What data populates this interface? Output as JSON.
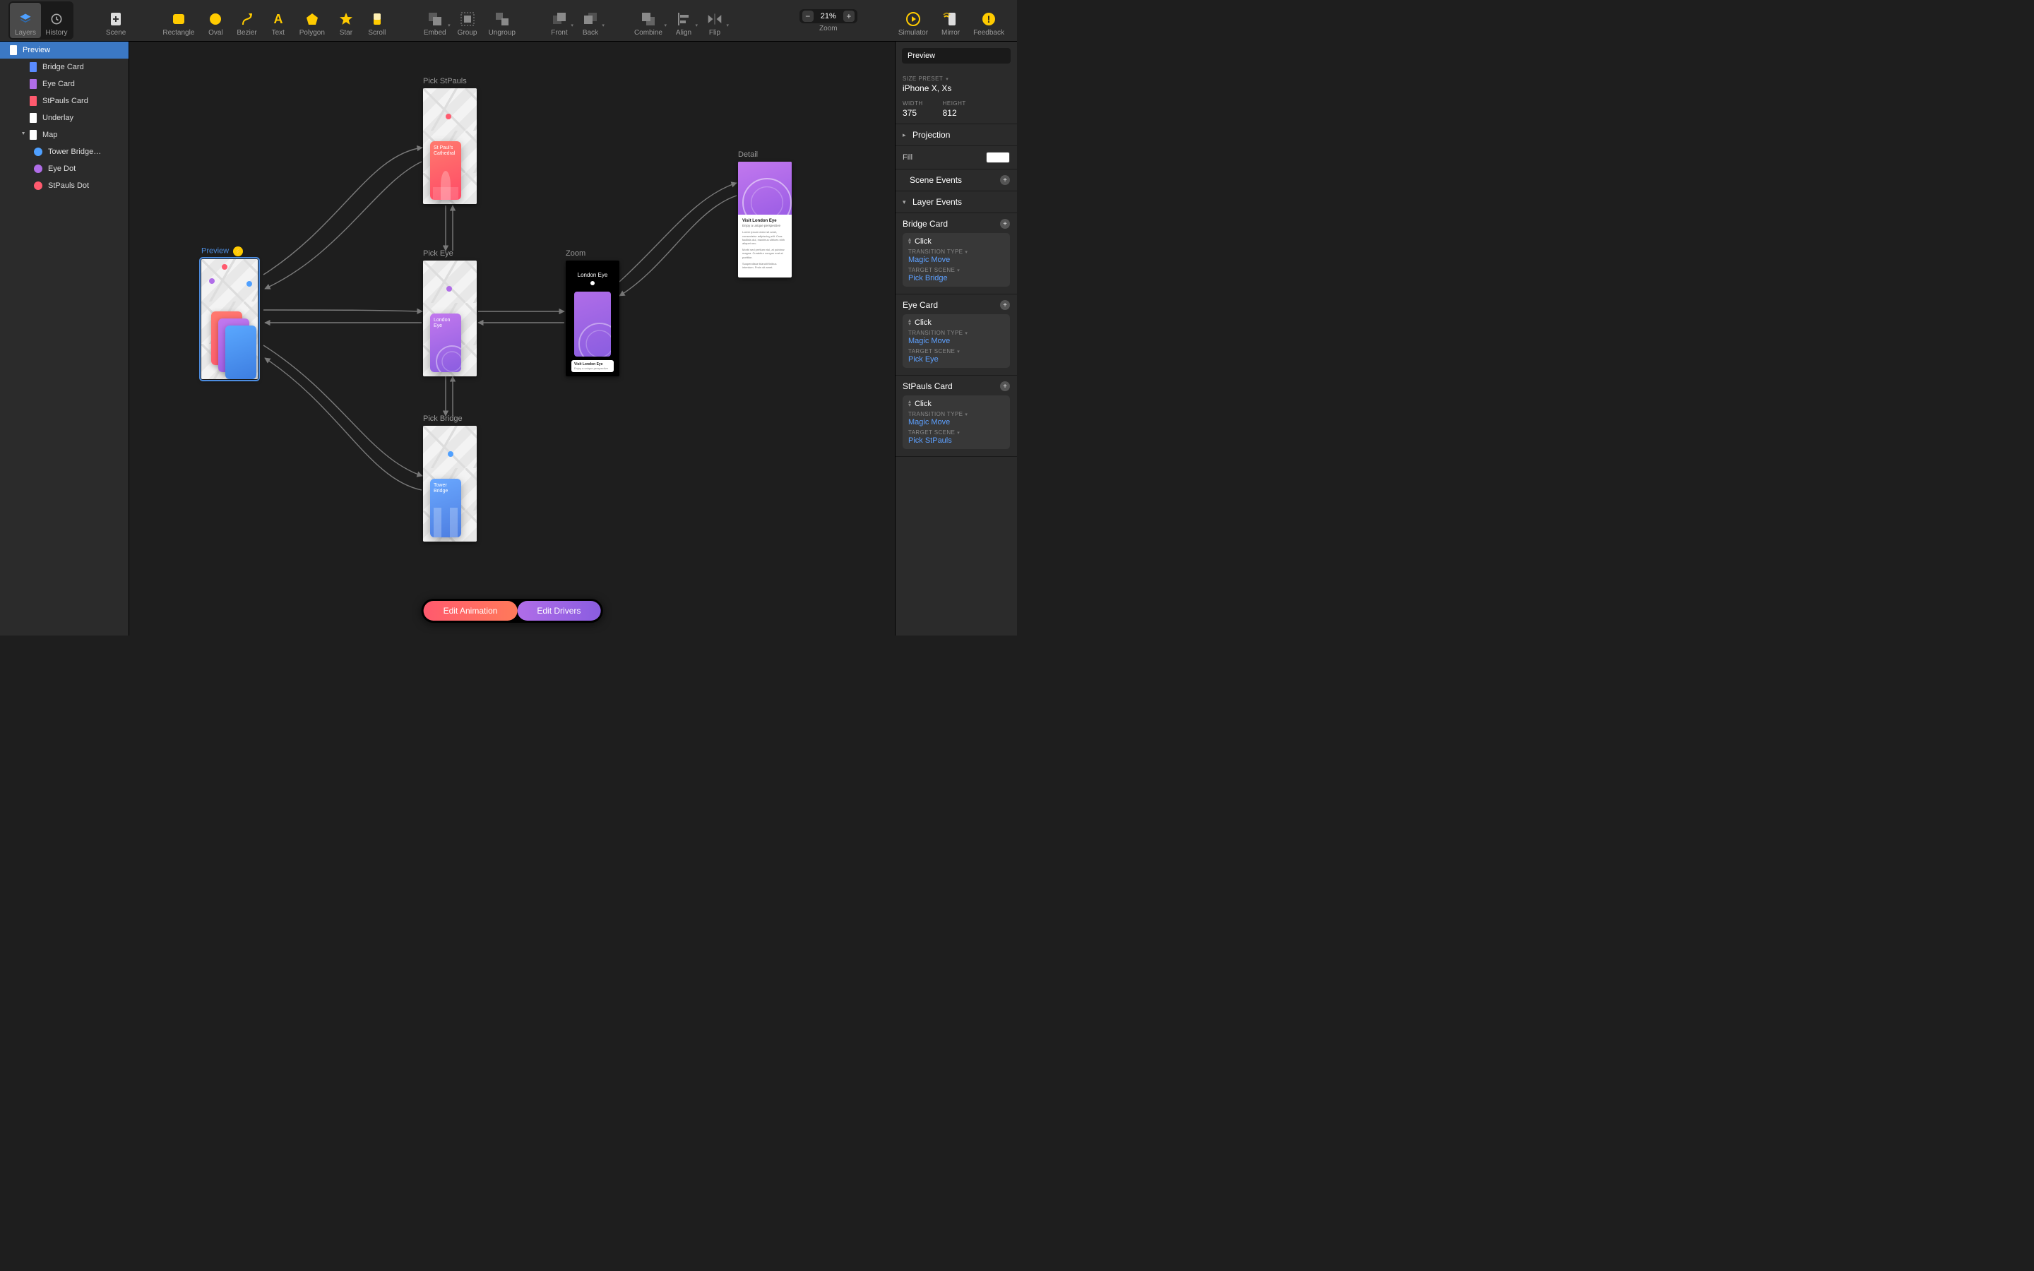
{
  "toolbar": {
    "layers": "Layers",
    "history": "History",
    "scene": "Scene",
    "rectangle": "Rectangle",
    "oval": "Oval",
    "bezier": "Bezier",
    "text": "Text",
    "polygon": "Polygon",
    "star": "Star",
    "scroll": "Scroll",
    "embed": "Embed",
    "group": "Group",
    "ungroup": "Ungroup",
    "front": "Front",
    "back": "Back",
    "combine": "Combine",
    "align": "Align",
    "flip": "Flip",
    "zoom_label": "Zoom",
    "zoom_value": "21%",
    "simulator": "Simulator",
    "mirror": "Mirror",
    "feedback": "Feedback"
  },
  "layers": [
    {
      "name": "Preview",
      "swatch": "#ffffff",
      "selected": true,
      "indent": 0,
      "kind": "rect"
    },
    {
      "name": "Bridge Card",
      "swatch": "#5a8bff",
      "selected": false,
      "indent": 1,
      "kind": "rect"
    },
    {
      "name": "Eye Card",
      "swatch": "#b06de8",
      "selected": false,
      "indent": 1,
      "kind": "rect"
    },
    {
      "name": "StPauls Card",
      "swatch": "#ff5a6e",
      "selected": false,
      "indent": 1,
      "kind": "rect"
    },
    {
      "name": "Underlay",
      "swatch": "#ffffff",
      "selected": false,
      "indent": 1,
      "kind": "rect"
    },
    {
      "name": "Map",
      "swatch": "#ffffff",
      "selected": false,
      "indent": 1,
      "kind": "rect",
      "disclosure": "open"
    },
    {
      "name": "Tower Bridge…",
      "swatch": "#4fa0ff",
      "selected": false,
      "indent": 2,
      "kind": "dot"
    },
    {
      "name": "Eye Dot",
      "swatch": "#b06de8",
      "selected": false,
      "indent": 2,
      "kind": "dot"
    },
    {
      "name": "StPauls Dot",
      "swatch": "#ff5a6e",
      "selected": false,
      "indent": 2,
      "kind": "dot"
    }
  ],
  "scenes": {
    "preview": {
      "title": "Preview",
      "selected": true,
      "bolt": true
    },
    "pickStPauls": {
      "title": "Pick StPauls"
    },
    "pickEye": {
      "title": "Pick Eye"
    },
    "pickBridge": {
      "title": "Pick Bridge"
    },
    "zoom": {
      "title": "Zoom",
      "heading": "London Eye",
      "cta_h": "Visit London Eye",
      "cta_s": "Enjoy a unique perspective"
    },
    "detail": {
      "title": "Detail",
      "h": "Visit London Eye",
      "s": "Enjoy a unique perspective",
      "p1": "Lorem ipsum dolor sit amet, consectetur adipiscing elit. Cras facilisis dui, maximus ultrices nibh aliquet nec.",
      "p2": "Morbi sed pretium nisl, at pulvinar magna. Curabitur congue erat at porttitor.",
      "p3": "Suspendisse blandit finibus interdum. Proin sit amet."
    },
    "cards": {
      "stpauls": "St Paul's Cathedral",
      "eye": "London Eye",
      "bridge": "Tower Bridge"
    }
  },
  "bottom": {
    "anim": "Edit Animation",
    "drv": "Edit Drivers"
  },
  "inspector": {
    "name": "Preview",
    "size_preset_label": "SIZE PRESET",
    "size_preset": "iPhone X, Xs",
    "width_label": "WIDTH",
    "width": "375",
    "height_label": "HEIGHT",
    "height": "812",
    "projection": "Projection",
    "fill": "Fill",
    "scene_events": "Scene Events",
    "layer_events": "Layer Events",
    "events": [
      {
        "layer": "Bridge Card",
        "trigger": "Click",
        "transition_type_label": "TRANSITION TYPE",
        "transition_type": "Magic Move",
        "target_scene_label": "TARGET SCENE",
        "target_scene": "Pick Bridge"
      },
      {
        "layer": "Eye Card",
        "trigger": "Click",
        "transition_type_label": "TRANSITION TYPE",
        "transition_type": "Magic Move",
        "target_scene_label": "TARGET SCENE",
        "target_scene": "Pick Eye"
      },
      {
        "layer": "StPauls Card",
        "trigger": "Click",
        "transition_type_label": "TRANSITION TYPE",
        "transition_type": "Magic Move",
        "target_scene_label": "TARGET SCENE",
        "target_scene": "Pick StPauls"
      }
    ]
  },
  "colors": {
    "blue": "#5a8bff",
    "purple": "#b06de8",
    "pink": "#ff5a6e",
    "accent": "#ffcb00"
  }
}
